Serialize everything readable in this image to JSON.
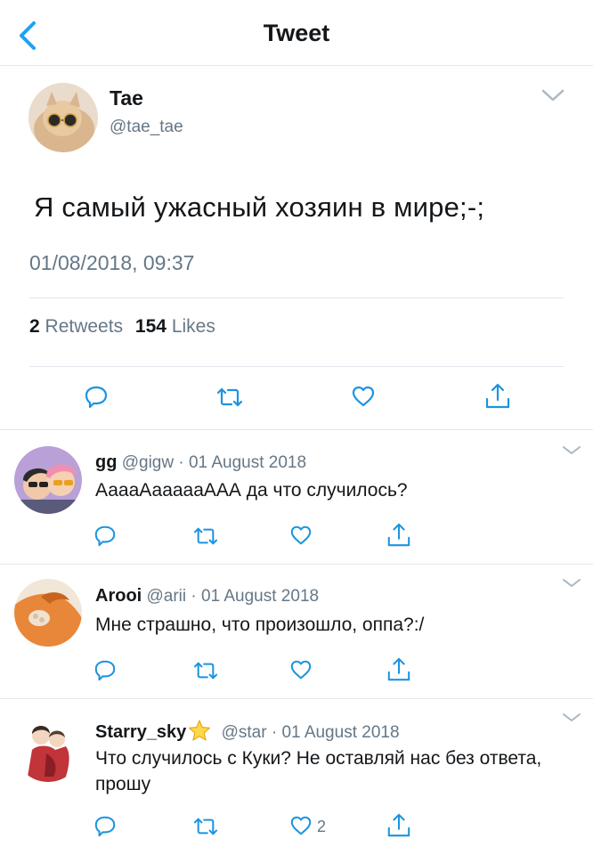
{
  "header": {
    "title": "Tweet",
    "back_icon": "chevron-left-icon",
    "accent": "#1da1f2"
  },
  "tweet": {
    "name": "Tae",
    "handle": "@tae_tae",
    "text": "Я самый ужасный хозяин в мире;-;",
    "datetime": "01/08/2018, 09:37",
    "retweets_count": "2",
    "retweets_label": "Retweets",
    "likes_count": "154",
    "likes_label": "Likes"
  },
  "replies": [
    {
      "name": "gg",
      "handle": "@gigw",
      "separator": "·",
      "date": "01 August 2018",
      "text": "АаааАаааааААА да что случилось?",
      "likes": ""
    },
    {
      "name": "Arooi",
      "handle": "@arii",
      "separator": "·",
      "date": "01 August 2018",
      "text": "Мне страшно, что произошло, оппа?:/",
      "likes": ""
    },
    {
      "name": "Starry_sky",
      "handle": "@star",
      "separator": "·",
      "date": "01 August 2018",
      "text": "Что случилось с Куки? Не оставляй нас без ответа, прошу",
      "likes": "2"
    }
  ],
  "colors": {
    "text": "#14171a",
    "secondary": "#657786",
    "divider": "#e1e8ed",
    "icon": "#1c94e0"
  }
}
